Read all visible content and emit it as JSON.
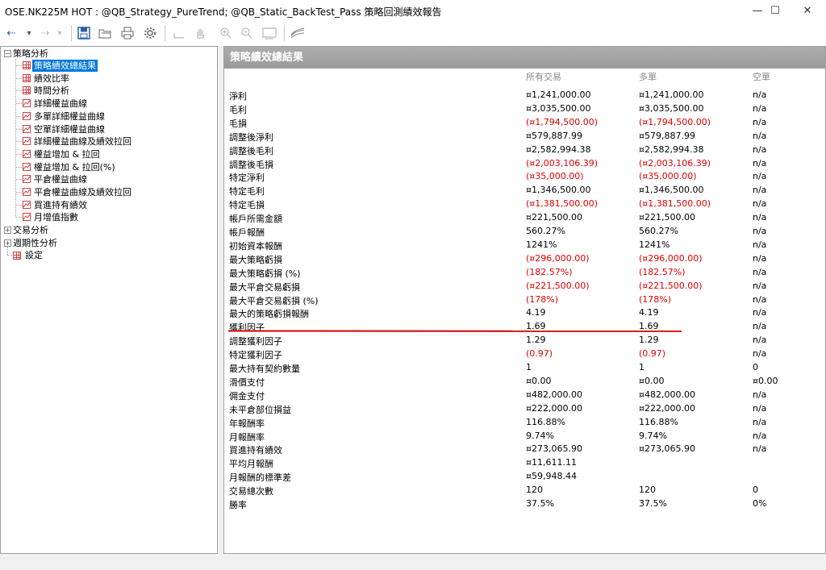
{
  "window": {
    "title": "OSE.NK225M HOT : @QB_Strategy_PureTrend; @QB_Static_BackTest_Pass 策略回測績效報告",
    "minimize_glyph": "—",
    "maximize_glyph": "☐",
    "close_glyph": "✕"
  },
  "toolbar": {
    "back_glyph": "⇠",
    "back_dropdown_glyph": "▾",
    "forward_glyph": "⇢",
    "forward_dropdown_glyph": "▾",
    "icons": [
      "back-arrow-icon",
      "forward-arrow-icon",
      "save-icon",
      "open-folder-icon",
      "print-icon",
      "settings-gear-icon",
      "crosshair-icon",
      "hand-pan-icon",
      "zoom-in-icon",
      "zoom-out-icon",
      "fit-screen-icon",
      "chart-style-icon"
    ]
  },
  "tree": {
    "root_strategy": "策略分析",
    "items": [
      {
        "label": "策略績效總結果",
        "icon": "grid-icon"
      },
      {
        "label": "績效比率",
        "icon": "grid-icon"
      },
      {
        "label": "時間分析",
        "icon": "grid-icon"
      },
      {
        "label": "詳細權益曲線",
        "icon": "chart-icon"
      },
      {
        "label": "多單詳細權益曲線",
        "icon": "chart-icon"
      },
      {
        "label": "空單詳細權益曲線",
        "icon": "chart-icon"
      },
      {
        "label": "詳細權益曲線及績效拉回",
        "icon": "chart-icon"
      },
      {
        "label": "權益增加 & 拉回",
        "icon": "chart-icon"
      },
      {
        "label": "權益增加 & 拉回(%)",
        "icon": "chart-icon"
      },
      {
        "label": "平倉權益曲線",
        "icon": "chart-icon"
      },
      {
        "label": "平倉權益曲線及績效拉回",
        "icon": "chart-icon"
      },
      {
        "label": "買進持有績效",
        "icon": "chart-icon"
      },
      {
        "label": "月增值指數",
        "icon": "chart-icon"
      }
    ],
    "root_trade": "交易分析",
    "root_period": "週期性分析",
    "settings": "設定"
  },
  "report": {
    "header": "策略績效總結果",
    "columns": [
      "所有交易",
      "多單",
      "空單"
    ],
    "rows": [
      {
        "label": "淨利",
        "all": "¤1,241,000.00",
        "long": "¤1,241,000.00",
        "short": "n/a",
        "neg": false
      },
      {
        "label": "毛利",
        "all": "¤3,035,500.00",
        "long": "¤3,035,500.00",
        "short": "n/a",
        "neg": false
      },
      {
        "label": "毛損",
        "all": "(¤1,794,500.00)",
        "long": "(¤1,794,500.00)",
        "short": "n/a",
        "neg": true
      },
      {
        "label": "調整後淨利",
        "all": "¤579,887.99",
        "long": "¤579,887.99",
        "short": "n/a",
        "neg": false
      },
      {
        "label": "調整後毛利",
        "all": "¤2,582,994.38",
        "long": "¤2,582,994.38",
        "short": "n/a",
        "neg": false
      },
      {
        "label": "調整後毛損",
        "all": "(¤2,003,106.39)",
        "long": "(¤2,003,106.39)",
        "short": "n/a",
        "neg": true
      },
      {
        "label": "特定淨利",
        "all": "(¤35,000.00)",
        "long": "(¤35,000.00)",
        "short": "n/a",
        "neg": true
      },
      {
        "label": "特定毛利",
        "all": "¤1,346,500.00",
        "long": "¤1,346,500.00",
        "short": "n/a",
        "neg": false
      },
      {
        "label": "特定毛損",
        "all": "(¤1,381,500.00)",
        "long": "(¤1,381,500.00)",
        "short": "n/a",
        "neg": true
      },
      {
        "label": "帳戶所需金額",
        "all": "¤221,500.00",
        "long": "¤221,500.00",
        "short": "n/a",
        "neg": false
      },
      {
        "label": "帳戶報酬",
        "all": "560.27%",
        "long": "560.27%",
        "short": "n/a",
        "neg": false
      },
      {
        "label": "初始資本報酬",
        "all": "1241%",
        "long": "1241%",
        "short": "n/a",
        "neg": false
      },
      {
        "label": "最大策略虧損",
        "all": "(¤296,000.00)",
        "long": "(¤296,000.00)",
        "short": "n/a",
        "neg": true
      },
      {
        "label": "最大策略虧損 (%)",
        "all": "(182.57%)",
        "long": "(182.57%)",
        "short": "n/a",
        "neg": true
      },
      {
        "label": "最大平倉交易虧損",
        "all": "(¤221,500.00)",
        "long": "(¤221,500.00)",
        "short": "n/a",
        "neg": true
      },
      {
        "label": "最大平倉交易虧損 (%)",
        "all": "(178%)",
        "long": "(178%)",
        "short": "n/a",
        "neg": true
      },
      {
        "label": "最大的策略虧損報酬",
        "all": "4.19",
        "long": "4.19",
        "short": "n/a",
        "neg": false
      },
      {
        "label": "獲利因子",
        "all": "1.69",
        "long": "1.69",
        "short": "n/a",
        "neg": false
      },
      {
        "label": "調整獲利因子",
        "all": "1.29",
        "long": "1.29",
        "short": "n/a",
        "neg": false
      },
      {
        "label": "特定獲利因子",
        "all": "(0.97)",
        "long": "(0.97)",
        "short": "n/a",
        "neg": true
      },
      {
        "label": "最大持有契約數量",
        "all": "1",
        "long": "1",
        "short": "0",
        "neg": false
      },
      {
        "label": "滑價支付",
        "all": "¤0.00",
        "long": "¤0.00",
        "short": "¤0.00",
        "neg": false
      },
      {
        "label": "佣金支付",
        "all": "¤482,000.00",
        "long": "¤482,000.00",
        "short": "n/a",
        "neg": false
      },
      {
        "label": "未平倉部位損益",
        "all": "¤222,000.00",
        "long": "¤222,000.00",
        "short": "n/a",
        "neg": false
      },
      {
        "label": "年報酬率",
        "all": "116.88%",
        "long": "116.88%",
        "short": "n/a",
        "neg": false
      },
      {
        "label": "月報酬率",
        "all": "9.74%",
        "long": "9.74%",
        "short": "n/a",
        "neg": false
      },
      {
        "label": "買進持有績效",
        "all": "¤273,065.90",
        "long": "¤273,065.90",
        "short": "n/a",
        "neg": false
      },
      {
        "label": "平均月報酬",
        "all": "¤11,611.11",
        "long": "",
        "short": "",
        "neg": false
      },
      {
        "label": "月報酬的標準差",
        "all": "¤59,948.44",
        "long": "",
        "short": "",
        "neg": false
      },
      {
        "label": "交易總次數",
        "all": "120",
        "long": "120",
        "short": "0",
        "neg": false
      },
      {
        "label": "勝率",
        "all": "37.5%",
        "long": "37.5%",
        "short": "0%",
        "neg": false
      }
    ]
  },
  "colors": {
    "negative": "#e00000",
    "selection": "#0078d7",
    "header_bg": "#a3a3a3",
    "annotation_line": "#d00000"
  }
}
